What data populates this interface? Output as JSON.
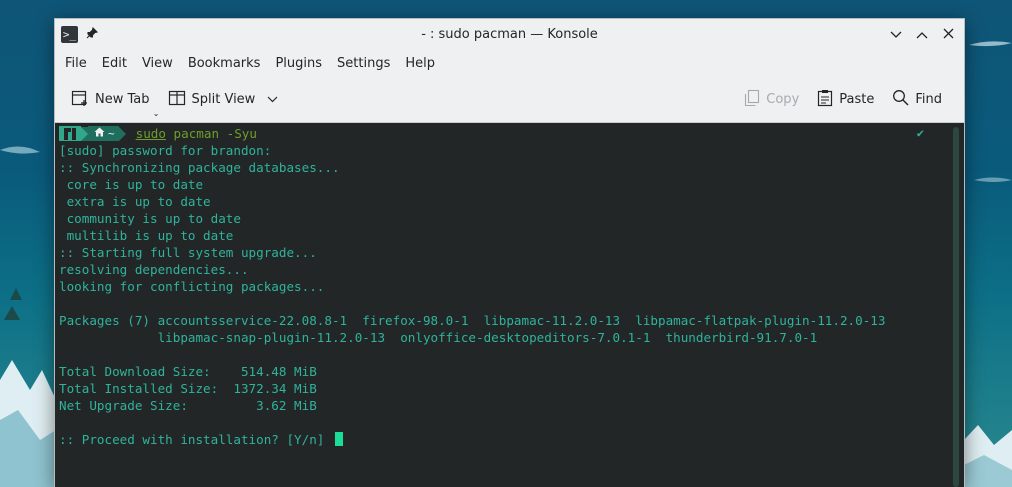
{
  "window": {
    "title": "- : sudo pacman — Konsole",
    "app_icon": "terminal-icon",
    "pin_icon": "pin-icon",
    "controls": [
      "chevron-down-icon",
      "chevron-up-icon",
      "close-icon"
    ]
  },
  "menubar": {
    "items": [
      "File",
      "Edit",
      "View",
      "Bookmarks",
      "Plugins",
      "Settings",
      "Help"
    ]
  },
  "toolbar": {
    "new_tab": "New Tab",
    "split_view": "Split View",
    "copy": "Copy",
    "paste": "Paste",
    "find": "Find"
  },
  "terminal": {
    "prompt_segment_icon": "manjaro-icon",
    "prompt_dir": "~",
    "command_prefix": "sudo",
    "command_rest": " pacman -Syu",
    "status_check": "✔",
    "lines": [
      "[sudo] password for brandon:",
      ":: Synchronizing package databases...",
      " core is up to date",
      " extra is up to date",
      " community is up to date",
      " multilib is up to date",
      ":: Starting full system upgrade...",
      "resolving dependencies...",
      "looking for conflicting packages...",
      "",
      "Packages (7) accountsservice-22.08.8-1  firefox-98.0-1  libpamac-11.2.0-13  libpamac-flatpak-plugin-11.2.0-13",
      "             libpamac-snap-plugin-11.2.0-13  onlyoffice-desktopeditors-7.0.1-1  thunderbird-91.7.0-1",
      "",
      "Total Download Size:    514.48 MiB",
      "Total Installed Size:  1372.34 MiB",
      "Net Upgrade Size:         3.62 MiB",
      "",
      ":: Proceed with installation? [Y/n] "
    ]
  },
  "colors": {
    "terminal_bg": "#232627",
    "terminal_text": "#2fb39c",
    "accent": "#1cdc9a",
    "command": "#6d9e2a"
  }
}
